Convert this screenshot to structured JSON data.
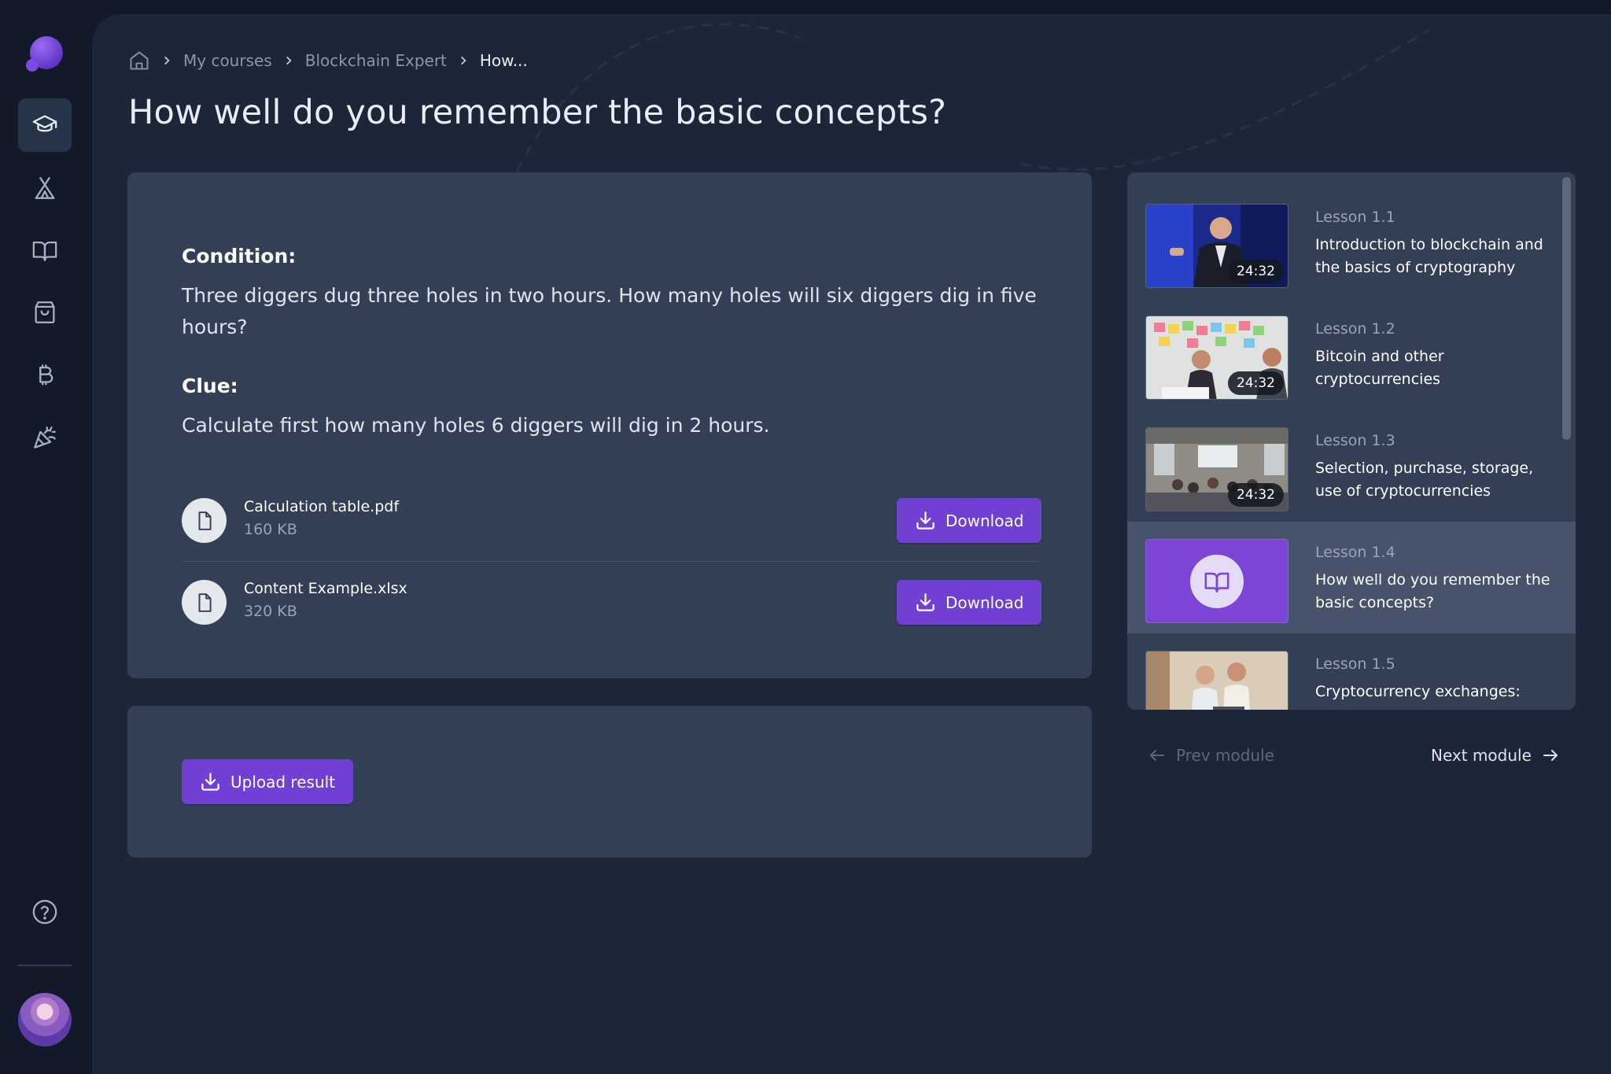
{
  "breadcrumb": {
    "home_icon": "home-icon",
    "items": [
      "My courses",
      "Blockchain Expert"
    ],
    "current": "How..."
  },
  "page": {
    "title": "How well do you remember the basic concepts?"
  },
  "task": {
    "condition_label": "Condition:",
    "condition_text": "Three diggers dug three holes in two hours. How many holes will six diggers dig in five hours?",
    "clue_label": "Clue:",
    "clue_text": "Calculate first how many holes 6 diggers will dig in 2 hours.",
    "files": [
      {
        "name": "Calculation table.pdf",
        "size": "160 KB",
        "button": "Download"
      },
      {
        "name": "Content Example.xlsx",
        "size": "320 KB",
        "button": "Download"
      }
    ]
  },
  "upload": {
    "button": "Upload result"
  },
  "lessons": [
    {
      "number": "Lesson 1.1",
      "title": "Introduction to blockchain and the basics of cryptography",
      "duration": "24:32",
      "thumb": "speaker"
    },
    {
      "number": "Lesson 1.2",
      "title": "Bitcoin and other cryptocurrencies",
      "duration": "24:32",
      "thumb": "office"
    },
    {
      "number": "Lesson 1.3",
      "title": "Selection, purchase, storage, use of cryptocurrencies",
      "duration": "24:32",
      "thumb": "classroom"
    },
    {
      "number": "Lesson 1.4",
      "title": "How well do you remember the basic concepts?",
      "duration": "",
      "thumb": "book-icon",
      "active": true
    },
    {
      "number": "Lesson 1.5",
      "title": "Cryptocurrency exchanges:",
      "duration": "",
      "thumb": "team"
    }
  ],
  "module_nav": {
    "prev": "Prev module",
    "next": "Next module"
  },
  "colors": {
    "accent": "#7040d2",
    "background": "#121a29",
    "panel": "#1c2638",
    "card": "#333f54",
    "active_lesson": "#47536a"
  },
  "sidebar": {
    "icons": [
      "logo",
      "graduation-cap-icon",
      "camp-icon",
      "book-icon",
      "shopping-bag-icon",
      "bitcoin-icon",
      "party-popper-icon",
      "help-icon",
      "avatar"
    ]
  }
}
